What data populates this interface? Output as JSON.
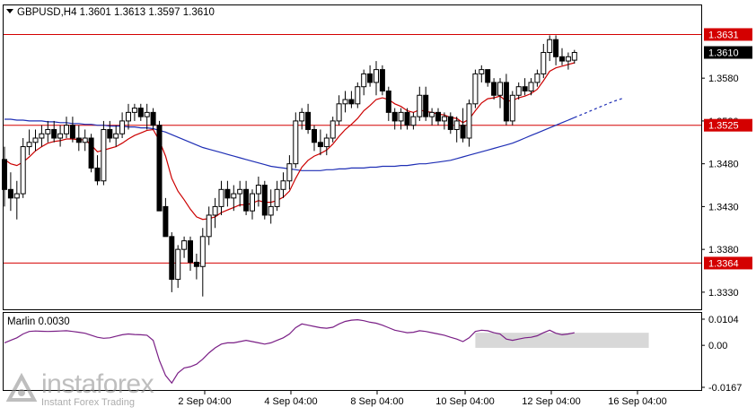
{
  "header": {
    "symbol_line": "GBPUSD,H4  1.3601  1.3613  1.3597  1.3610",
    "indicator_label": "Marlin 0.0030"
  },
  "watermark": {
    "brand": "instaforex",
    "tagline": "Instant Forex Trading"
  },
  "colors": {
    "bull": "#ffffff",
    "bear": "#000000",
    "ema": "#cc0000",
    "sma": "#1f2fb5",
    "marlin": "#7a1f86",
    "level": "#d40000",
    "price_box": "#000000",
    "zone": "#d8d8d8"
  },
  "chart_data": [
    {
      "type": "candlestick",
      "title": "GBPUSD,H4",
      "ohlc_last": {
        "open": 1.3601,
        "high": 1.3613,
        "low": 1.3597,
        "close": 1.361
      },
      "ylim": [
        1.331,
        1.3665
      ],
      "y_ticks": [
        "1.3330",
        "1.3380",
        "1.3430",
        "1.3480",
        "1.3530",
        "1.3580"
      ],
      "x_ticks": [
        "2 Sep 04:00",
        "4 Sep 04:00",
        "8 Sep 04:00",
        "10 Sep 04:00",
        "12 Sep 04:00",
        "16 Sep 04:00"
      ],
      "current_price": "1.3610",
      "levels": [
        {
          "value": 1.3631,
          "label": "1.3631"
        },
        {
          "value": 1.3525,
          "label": "1.3525"
        },
        {
          "value": 1.3364,
          "label": "1.3364"
        }
      ],
      "candles": [
        [
          1.3485,
          1.35,
          1.343,
          1.345
        ],
        [
          1.345,
          1.347,
          1.3425,
          1.344
        ],
        [
          1.344,
          1.346,
          1.3415,
          1.3445
        ],
        [
          1.3445,
          1.351,
          1.344,
          1.35
        ],
        [
          1.35,
          1.352,
          1.349,
          1.3505
        ],
        [
          1.3505,
          1.352,
          1.3495,
          1.351
        ],
        [
          1.351,
          1.3525,
          1.35,
          1.3515
        ],
        [
          1.3515,
          1.353,
          1.3505,
          1.352
        ],
        [
          1.352,
          1.353,
          1.3505,
          1.351
        ],
        [
          1.351,
          1.3525,
          1.35,
          1.3515
        ],
        [
          1.3515,
          1.3535,
          1.351,
          1.3525
        ],
        [
          1.3525,
          1.3535,
          1.3505,
          1.351
        ],
        [
          1.351,
          1.3525,
          1.3495,
          1.3505
        ],
        [
          1.3505,
          1.352,
          1.3495,
          1.351
        ],
        [
          1.351,
          1.3515,
          1.347,
          1.3475
        ],
        [
          1.3475,
          1.349,
          1.3455,
          1.346
        ],
        [
          1.346,
          1.353,
          1.3455,
          1.352
        ],
        [
          1.352,
          1.353,
          1.3505,
          1.351
        ],
        [
          1.351,
          1.3525,
          1.35,
          1.3515
        ],
        [
          1.3515,
          1.354,
          1.351,
          1.353
        ],
        [
          1.353,
          1.355,
          1.352,
          1.354
        ],
        [
          1.354,
          1.355,
          1.353,
          1.3545
        ],
        [
          1.3545,
          1.355,
          1.353,
          1.3535
        ],
        [
          1.3535,
          1.355,
          1.352,
          1.354
        ],
        [
          1.354,
          1.3545,
          1.352,
          1.3525
        ],
        [
          1.3525,
          1.353,
          1.3445,
          1.3425
        ],
        [
          1.343,
          1.344,
          1.3395,
          1.3395
        ],
        [
          1.3395,
          1.34,
          1.333,
          1.3345
        ],
        [
          1.3345,
          1.3385,
          1.3335,
          1.338
        ],
        [
          1.338,
          1.3395,
          1.337,
          1.339
        ],
        [
          1.339,
          1.3395,
          1.3355,
          1.3365
        ],
        [
          1.3365,
          1.3375,
          1.3345,
          1.336
        ],
        [
          1.336,
          1.3405,
          1.3325,
          1.3395
        ],
        [
          1.3395,
          1.343,
          1.3385,
          1.342
        ],
        [
          1.342,
          1.344,
          1.3405,
          1.343
        ],
        [
          1.343,
          1.346,
          1.342,
          1.345
        ],
        [
          1.345,
          1.346,
          1.343,
          1.344
        ],
        [
          1.344,
          1.3455,
          1.3425,
          1.3445
        ],
        [
          1.3445,
          1.346,
          1.343,
          1.345
        ],
        [
          1.345,
          1.346,
          1.342,
          1.3425
        ],
        [
          1.3425,
          1.345,
          1.3415,
          1.3445
        ],
        [
          1.3445,
          1.3465,
          1.343,
          1.3455
        ],
        [
          1.3455,
          1.346,
          1.3415,
          1.342
        ],
        [
          1.342,
          1.345,
          1.341,
          1.343
        ],
        [
          1.343,
          1.346,
          1.3425,
          1.345
        ],
        [
          1.345,
          1.347,
          1.344,
          1.346
        ],
        [
          1.346,
          1.349,
          1.345,
          1.348
        ],
        [
          1.348,
          1.354,
          1.3475,
          1.353
        ],
        [
          1.353,
          1.3545,
          1.352,
          1.354
        ],
        [
          1.354,
          1.355,
          1.3515,
          1.352
        ],
        [
          1.352,
          1.3525,
          1.3495,
          1.3505
        ],
        [
          1.3505,
          1.352,
          1.349,
          1.35
        ],
        [
          1.35,
          1.3515,
          1.349,
          1.351
        ],
        [
          1.351,
          1.3535,
          1.3505,
          1.353
        ],
        [
          1.353,
          1.356,
          1.3525,
          1.355
        ],
        [
          1.355,
          1.3565,
          1.354,
          1.3555
        ],
        [
          1.3555,
          1.3565,
          1.3545,
          1.355
        ],
        [
          1.355,
          1.3575,
          1.3545,
          1.357
        ],
        [
          1.357,
          1.359,
          1.356,
          1.3585
        ],
        [
          1.3585,
          1.3595,
          1.357,
          1.3575
        ],
        [
          1.3575,
          1.36,
          1.356,
          1.359
        ],
        [
          1.359,
          1.3595,
          1.356,
          1.3565
        ],
        [
          1.3565,
          1.357,
          1.353,
          1.354
        ],
        [
          1.354,
          1.3545,
          1.352,
          1.353
        ],
        [
          1.353,
          1.3545,
          1.352,
          1.354
        ],
        [
          1.354,
          1.3545,
          1.352,
          1.3525
        ],
        [
          1.3525,
          1.354,
          1.352,
          1.3535
        ],
        [
          1.3535,
          1.357,
          1.353,
          1.356
        ],
        [
          1.356,
          1.357,
          1.353,
          1.3535
        ],
        [
          1.3535,
          1.3545,
          1.3525,
          1.354
        ],
        [
          1.354,
          1.3545,
          1.3525,
          1.353
        ],
        [
          1.353,
          1.354,
          1.352,
          1.3535
        ],
        [
          1.3535,
          1.354,
          1.3515,
          1.352
        ],
        [
          1.352,
          1.3535,
          1.3505,
          1.353
        ],
        [
          1.3525,
          1.3545,
          1.3505,
          1.351
        ],
        [
          1.351,
          1.3555,
          1.35,
          1.355
        ],
        [
          1.355,
          1.359,
          1.3545,
          1.3585
        ],
        [
          1.3585,
          1.3595,
          1.3575,
          1.359
        ],
        [
          1.359,
          1.359,
          1.357,
          1.3575
        ],
        [
          1.3575,
          1.358,
          1.3555,
          1.356
        ],
        [
          1.356,
          1.358,
          1.3545,
          1.3575
        ],
        [
          1.3575,
          1.3585,
          1.3525,
          1.353
        ],
        [
          1.353,
          1.3565,
          1.3525,
          1.356
        ],
        [
          1.356,
          1.3575,
          1.3555,
          1.357
        ],
        [
          1.357,
          1.358,
          1.356,
          1.3565
        ],
        [
          1.3565,
          1.358,
          1.356,
          1.3575
        ],
        [
          1.3575,
          1.359,
          1.357,
          1.3585
        ],
        [
          1.3585,
          1.362,
          1.358,
          1.361
        ],
        [
          1.361,
          1.363,
          1.36,
          1.3625
        ],
        [
          1.3625,
          1.363,
          1.3595,
          1.3605
        ],
        [
          1.3605,
          1.3615,
          1.3595,
          1.36
        ],
        [
          1.36,
          1.361,
          1.359,
          1.3605
        ],
        [
          1.3601,
          1.3613,
          1.3597,
          1.361
        ]
      ],
      "ema_red": [
        1.3485,
        1.348,
        1.3478,
        1.3482,
        1.3488,
        1.3495,
        1.35,
        1.3504,
        1.3506,
        1.3507,
        1.3509,
        1.3509,
        1.3508,
        1.3508,
        1.3502,
        1.3494,
        1.3496,
        1.3498,
        1.35,
        1.3504,
        1.3509,
        1.3513,
        1.3516,
        1.3519,
        1.352,
        1.3507,
        1.3489,
        1.3463,
        1.3448,
        1.3438,
        1.3427,
        1.3418,
        1.3415,
        1.3416,
        1.3418,
        1.3423,
        1.3426,
        1.3429,
        1.3432,
        1.3432,
        1.3434,
        1.3437,
        1.3435,
        1.3435,
        1.3437,
        1.3441,
        1.3448,
        1.3463,
        1.3476,
        1.3484,
        1.3489,
        1.3492,
        1.3496,
        1.3503,
        1.3512,
        1.352,
        1.3526,
        1.3533,
        1.3542,
        1.3548,
        1.3555,
        1.3557,
        1.3555,
        1.355,
        1.3547,
        1.3542,
        1.354,
        1.3543,
        1.3541,
        1.354,
        1.3538,
        1.3537,
        1.3534,
        1.3533,
        1.3528,
        1.3532,
        1.3542,
        1.3551,
        1.3556,
        1.3557,
        1.3559,
        1.3553,
        1.3554,
        1.3557,
        1.3559,
        1.3562,
        1.3567,
        1.3577,
        1.3588,
        1.3592,
        1.3594,
        1.3596,
        1.3598
      ],
      "sma_blue": [
        1.3532,
        1.3532,
        1.3531,
        1.3531,
        1.353,
        1.353,
        1.353,
        1.3529,
        1.3529,
        1.3528,
        1.3528,
        1.3527,
        1.3527,
        1.3526,
        1.3526,
        1.3525,
        1.3525,
        1.3524,
        1.3524,
        1.3524,
        1.3523,
        1.3523,
        1.3522,
        1.3522,
        1.3521,
        1.3519,
        1.3517,
        1.3514,
        1.3511,
        1.3508,
        1.3505,
        1.3502,
        1.3499,
        1.3497,
        1.3495,
        1.3493,
        1.3491,
        1.3489,
        1.3487,
        1.3485,
        1.3483,
        1.3481,
        1.3479,
        1.3477,
        1.3476,
        1.3475,
        1.3474,
        1.3473,
        1.3472,
        1.3472,
        1.3472,
        1.3472,
        1.3473,
        1.3473,
        1.3474,
        1.3474,
        1.3475,
        1.3475,
        1.3475,
        1.3476,
        1.3476,
        1.3477,
        1.3477,
        1.3477,
        1.3478,
        1.3478,
        1.3479,
        1.348,
        1.348,
        1.3481,
        1.3482,
        1.3483,
        1.3484,
        1.3486,
        1.3488,
        1.349,
        1.3492,
        1.3494,
        1.3496,
        1.3498,
        1.35,
        1.3502,
        1.3504,
        1.3507,
        1.351,
        1.3513,
        1.3516,
        1.3519,
        1.3522,
        1.3525,
        1.3528,
        1.3531,
        1.3534
      ],
      "sma_projection": [
        1.3534,
        1.354,
        1.3546,
        1.3552,
        1.3557
      ],
      "marlin": {
        "label": "Marlin 0.0030",
        "ylim": [
          -0.0167,
          0.0104
        ],
        "y_ticks": [
          "0.0104",
          "0.00",
          "-0.0167"
        ],
        "values": [
          0.001,
          0.002,
          0.003,
          0.0045,
          0.0055,
          0.0057,
          0.0056,
          0.0055,
          0.0056,
          0.0057,
          0.0058,
          0.0055,
          0.0052,
          0.0048,
          0.004,
          0.0032,
          0.0028,
          0.003,
          0.0036,
          0.0042,
          0.0045,
          0.0043,
          0.0042,
          0.004,
          0.002,
          -0.006,
          -0.012,
          -0.015,
          -0.011,
          -0.009,
          -0.0085,
          -0.0075,
          -0.0055,
          -0.003,
          -0.001,
          0.0005,
          0.001,
          0.001,
          0.0015,
          0.002,
          0.0015,
          0.001,
          0.0005,
          0.001,
          0.002,
          0.003,
          0.0045,
          0.007,
          0.0085,
          0.008,
          0.0075,
          0.007,
          0.0068,
          0.0072,
          0.0085,
          0.0095,
          0.01,
          0.0102,
          0.0098,
          0.0092,
          0.0088,
          0.008,
          0.007,
          0.006,
          0.0055,
          0.005,
          0.0052,
          0.0058,
          0.0055,
          0.005,
          0.0045,
          0.004,
          0.0032,
          0.0025,
          0.0015,
          0.003,
          0.0055,
          0.006,
          0.0058,
          0.005,
          0.0045,
          0.0025,
          0.002,
          0.0025,
          0.003,
          0.0032,
          0.0038,
          0.005,
          0.006,
          0.0048,
          0.0042,
          0.0045,
          0.005
        ],
        "zone": [
          0.005,
          -0.001
        ]
      }
    }
  ]
}
